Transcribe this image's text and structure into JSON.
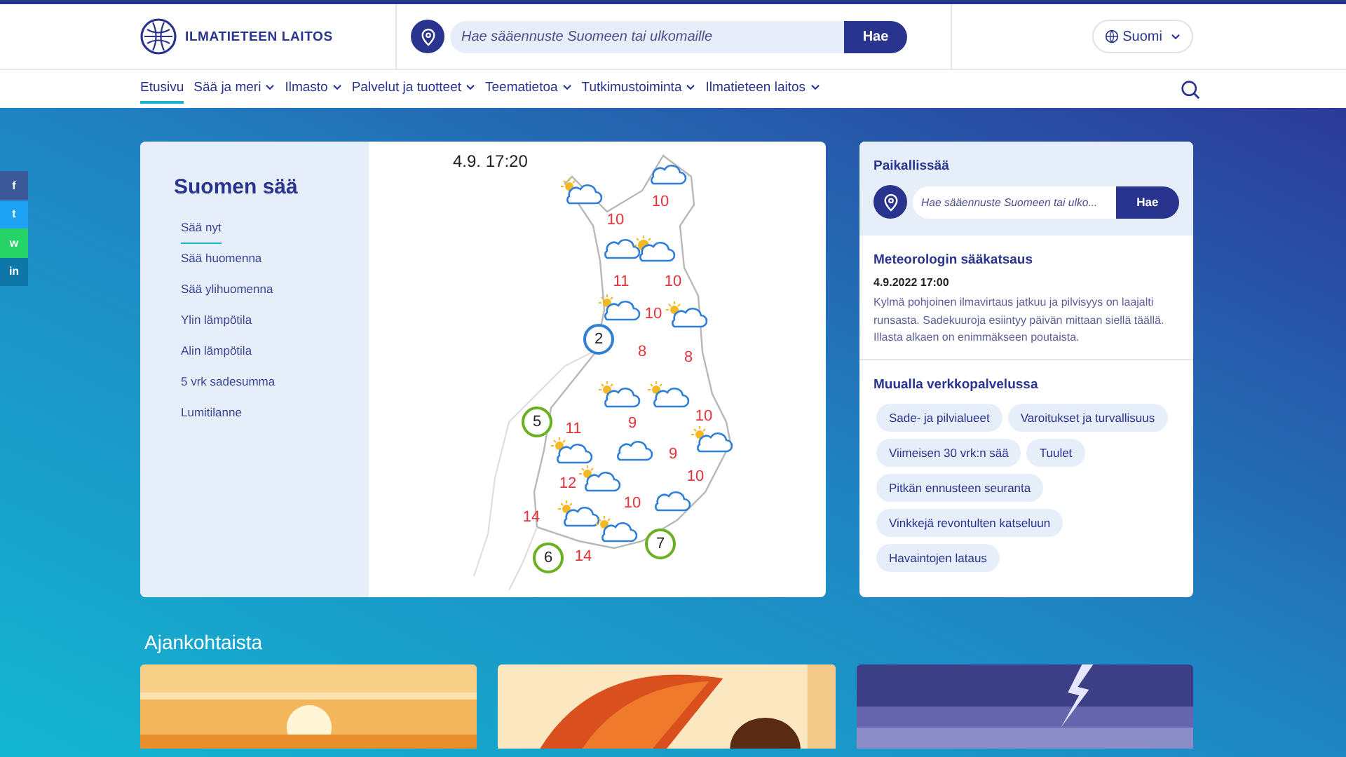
{
  "header": {
    "logo_text": "ILMATIETEEN LAITOS",
    "search": {
      "placeholder": "Hae sääennuste Suomeen tai ulkomaille",
      "button": "Hae"
    },
    "language": "Suomi"
  },
  "nav": [
    {
      "label": "Etusivu",
      "selected": true,
      "dropdown": false
    },
    {
      "label": "Sää ja meri",
      "selected": false,
      "dropdown": true
    },
    {
      "label": "Ilmasto",
      "selected": false,
      "dropdown": true
    },
    {
      "label": "Palvelut ja tuotteet",
      "selected": false,
      "dropdown": true
    },
    {
      "label": "Teematietoa",
      "selected": false,
      "dropdown": true
    },
    {
      "label": "Tutkimustoiminta",
      "selected": false,
      "dropdown": true
    },
    {
      "label": "Ilmatieteen laitos",
      "selected": false,
      "dropdown": true
    }
  ],
  "social": [
    {
      "label": "f",
      "color": "#3b5998"
    },
    {
      "label": "t",
      "color": "#1da1f2"
    },
    {
      "label": "w",
      "color": "#25d366"
    },
    {
      "label": "in",
      "color": "#0e76a8"
    }
  ],
  "weather": {
    "title": "Suomen sää",
    "links": [
      {
        "label": "Sää nyt",
        "selected": true
      },
      {
        "label": "Sää huomenna",
        "selected": false
      },
      {
        "label": "Sää ylihuomenna",
        "selected": false
      },
      {
        "label": "Ylin lämpötila",
        "selected": false
      },
      {
        "label": "Alin lämpötila",
        "selected": false
      },
      {
        "label": "5 vrk sadesumma",
        "selected": false
      },
      {
        "label": "Lumitilanne",
        "selected": false
      }
    ],
    "time": "4.9. 17:20",
    "temperatures": [
      "10",
      "10",
      "11",
      "10",
      "10",
      "8",
      "8",
      "10",
      "9",
      "11",
      "9",
      "10",
      "12",
      "10",
      "14",
      "14"
    ],
    "markers": [
      {
        "label": "2",
        "color": "#2f7fd8"
      },
      {
        "label": "5",
        "color": "#6ab023"
      },
      {
        "label": "6",
        "color": "#6ab023"
      },
      {
        "label": "7",
        "color": "#6ab023"
      }
    ]
  },
  "local": {
    "title": "Paikallissää",
    "placeholder": "Hae sääennuste Suomeen tai ulko...",
    "button": "Hae"
  },
  "review": {
    "title": "Meteorologin sääkatsaus",
    "date": "4.9.2022 17:00",
    "text": "Kylmä pohjoinen ilmavirtaus jatkuu ja pilvisyys on laajalti runsasta. Sadekuuroja esiintyy päivän mittaan siellä täällä. Illasta alkaen on enimmäkseen poutaista."
  },
  "elsewhere": {
    "title": "Muualla verkkopalvelussa",
    "links": [
      "Sade- ja pilvialueet",
      "Varoitukset ja turvallisuus",
      "Viimeisen 30 vrk:n sää",
      "Tuulet",
      "Pitkän ennusteen seuranta",
      "Vinkkejä revontulten katseluun",
      "Havaintojen lataus"
    ]
  },
  "news": {
    "title": "Ajankohtaista"
  }
}
